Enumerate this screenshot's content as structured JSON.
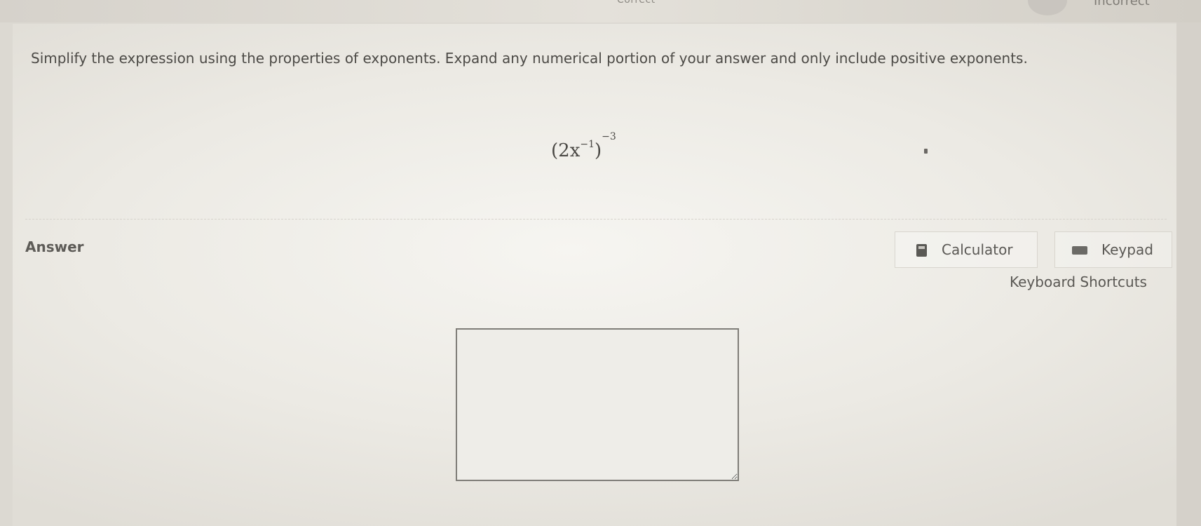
{
  "status": {
    "correct_label": "Correct",
    "incorrect_label": "Incorrect"
  },
  "question": {
    "prompt": "Simplify the expression using the properties of exponents. Expand any numerical portion of your answer and only include positive exponents.",
    "expression": {
      "open_paren": "(",
      "base": "2x",
      "inner_exponent": "−1",
      "close_paren": ")",
      "outer_exponent": "−3"
    }
  },
  "answer": {
    "label": "Answer",
    "value": ""
  },
  "tools": {
    "calculator_label": "Calculator",
    "keypad_label": "Keypad",
    "shortcuts_label": "Keyboard Shortcuts"
  },
  "colors": {
    "card_background": "#efeee9",
    "text": "#4c4a46",
    "input_border": "#7f7d78"
  },
  "icons": [
    "calculator-icon",
    "keypad-icon"
  ]
}
